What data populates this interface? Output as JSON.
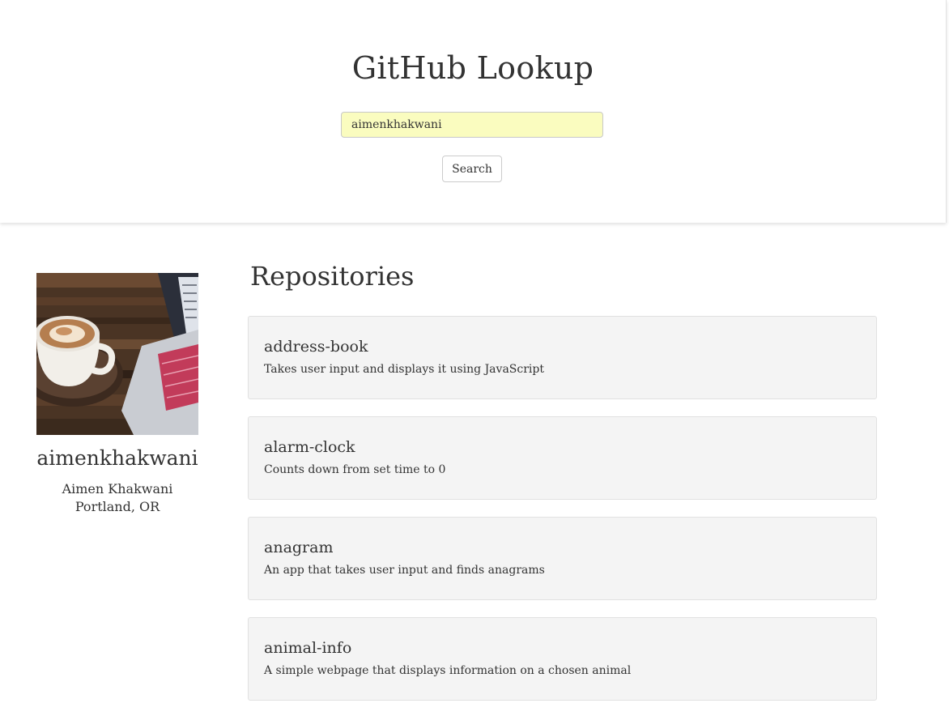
{
  "header": {
    "title": "GitHub Lookup",
    "search_value": "aimenkhakwani",
    "search_button_label": "Search"
  },
  "profile": {
    "username": "aimenkhakwani",
    "name": "Aimen Khakwani",
    "location": "Portland, OR",
    "avatar_icon": "avatar-photo-coffee-laptop"
  },
  "repositories": {
    "heading": "Repositories",
    "items": [
      {
        "name": "address-book",
        "description": "Takes user input and displays it using JavaScript"
      },
      {
        "name": "alarm-clock",
        "description": "Counts down from set time to 0"
      },
      {
        "name": "anagram",
        "description": "An app that takes user input and finds anagrams"
      },
      {
        "name": "animal-info",
        "description": "A simple webpage that displays information on a chosen animal"
      }
    ]
  },
  "colors": {
    "input_background": "#fafcbf",
    "card_background": "#f4f4f4",
    "text": "#333333"
  }
}
